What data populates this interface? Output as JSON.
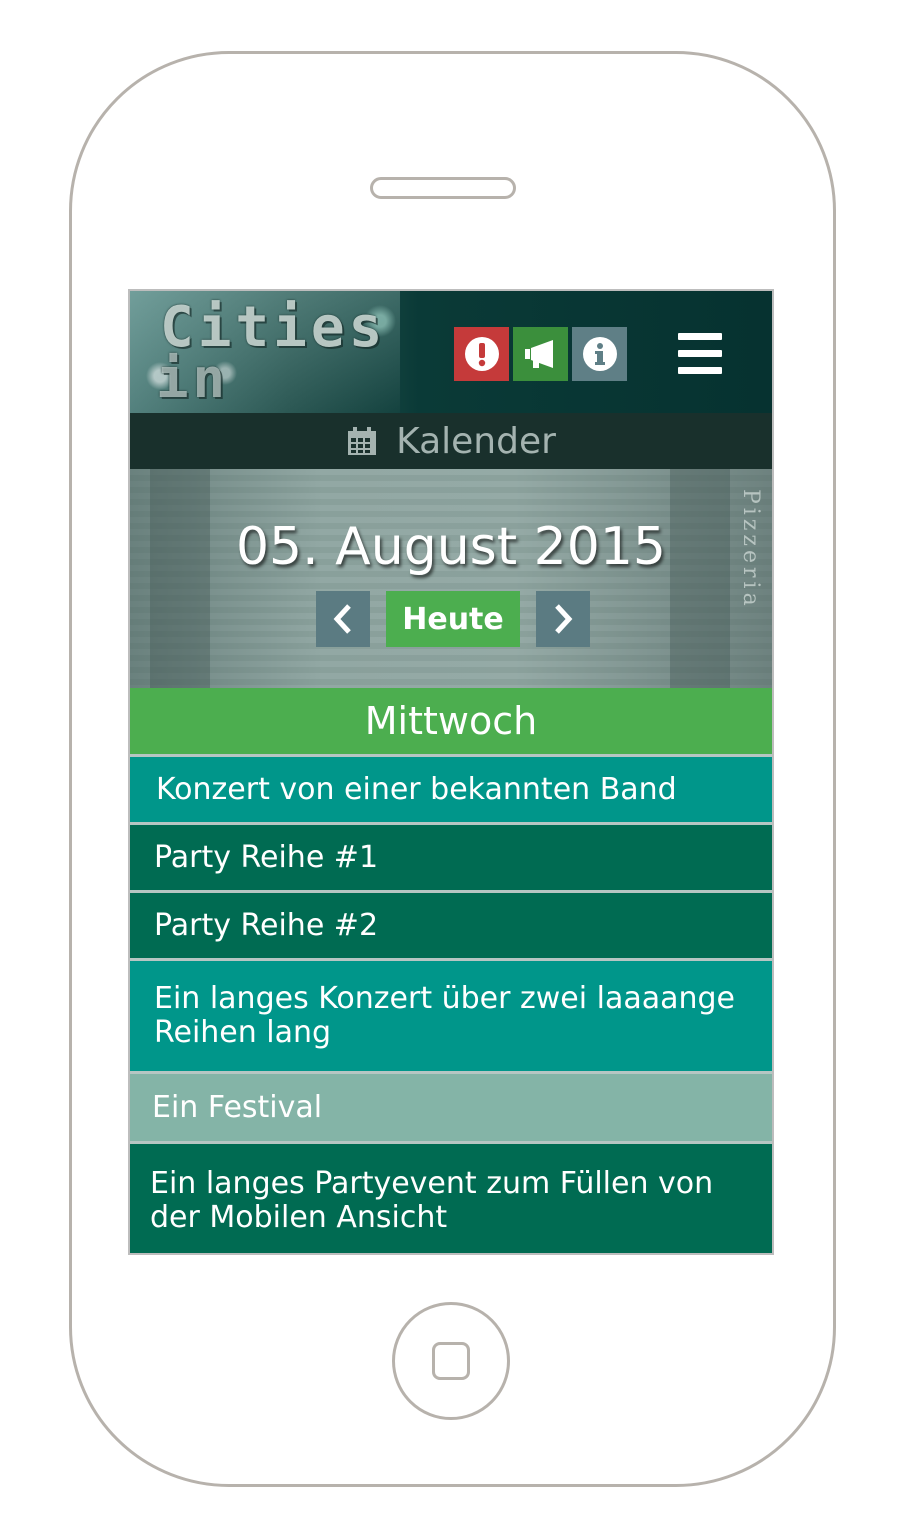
{
  "header": {
    "logo_line1": "Cities",
    "logo_line2": "in Dust",
    "icons": [
      "exclamation-icon",
      "megaphone-icon",
      "info-icon",
      "hamburger-menu-icon"
    ]
  },
  "subheader": {
    "label": "Kalender",
    "icon": "calendar-icon"
  },
  "date_nav": {
    "date": "05. August 2015",
    "today_label": "Heute",
    "side_text": "Pizzeria"
  },
  "weekday": "Mittwoch",
  "events": [
    {
      "title": "Konzert von einer bekannten Band",
      "color": "#00968a"
    },
    {
      "title": "Party Reihe #1",
      "color": "#006b52"
    },
    {
      "title": "Party Reihe #2",
      "color": "#006b52"
    },
    {
      "title": "Ein langes Konzert über zwei laaaange Reihen lang",
      "color": "#00968a"
    },
    {
      "title": "Ein Festival",
      "color": "#84b4a7"
    },
    {
      "title": "Ein langes Partyevent zum Füllen von der Mobilen Ansicht",
      "color": "#006b52"
    }
  ],
  "colors": {
    "alert": "#c53a3a",
    "megaphone": "#3b8f3c",
    "info": "#5f7f86",
    "today": "#4cae4f",
    "nav_arrow_bg": "#5b7b82",
    "subheader_bg": "#19302c"
  }
}
